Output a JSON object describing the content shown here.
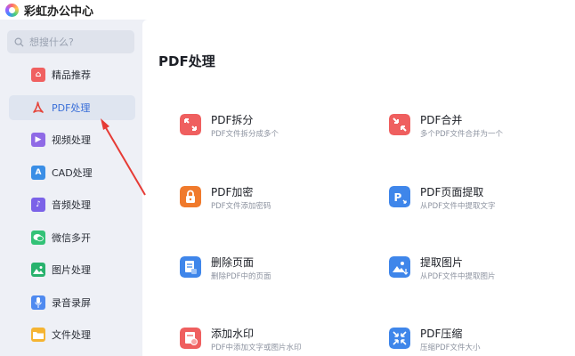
{
  "app": {
    "title": "彩虹办公中心"
  },
  "search": {
    "placeholder": "想搜什么?"
  },
  "sidebar": {
    "items": [
      {
        "label": "精品推荐",
        "icon": "home-icon",
        "color": "#f06060",
        "glyph": "⌂"
      },
      {
        "label": "PDF处理",
        "icon": "pdf-icon",
        "color": "#ffffff",
        "glyph": "A",
        "active": true
      },
      {
        "label": "视频处理",
        "icon": "video-icon",
        "color": "#8f6ae6",
        "glyph": "▶"
      },
      {
        "label": "CAD处理",
        "icon": "cad-icon",
        "color": "#3a8ee6",
        "glyph": "A"
      },
      {
        "label": "音频处理",
        "icon": "audio-icon",
        "color": "#7b62e8",
        "glyph": "♪"
      },
      {
        "label": "微信多开",
        "icon": "wechat-icon",
        "color": "#33c277",
        "glyph": "●"
      },
      {
        "label": "图片处理",
        "icon": "image-icon",
        "color": "#28b26d",
        "glyph": "▲"
      },
      {
        "label": "录音录屏",
        "icon": "mic-icon",
        "color": "#4f8af0",
        "glyph": "●"
      },
      {
        "label": "文件处理",
        "icon": "folder-icon",
        "color": "#f5b432",
        "glyph": "▬"
      }
    ]
  },
  "main": {
    "title": "PDF处理",
    "tools": [
      {
        "name": "PDF拆分",
        "desc": "PDF文件拆分成多个",
        "icon": "split-icon",
        "color": "#ef5f5f"
      },
      {
        "name": "PDF合并",
        "desc": "多个PDF文件合并为一个",
        "icon": "merge-icon",
        "color": "#ef5f5f"
      },
      {
        "name": "PDF加密",
        "desc": "PDF文件添加密码",
        "icon": "lock-icon",
        "color": "#f07a2c"
      },
      {
        "name": "PDF页面提取",
        "desc": "从PDF文件中提取文字",
        "icon": "page-extract-icon",
        "color": "#3f86ea"
      },
      {
        "name": "删除页面",
        "desc": "删除PDF中的页面",
        "icon": "delete-page-icon",
        "color": "#3f86ea"
      },
      {
        "name": "提取图片",
        "desc": "从PDF文件中提取图片",
        "icon": "image-extract-icon",
        "color": "#3f86ea"
      },
      {
        "name": "添加水印",
        "desc": "PDF中添加文字或图片水印",
        "icon": "watermark-icon",
        "color": "#ef5f5f"
      },
      {
        "name": "PDF压缩",
        "desc": "压缩PDF文件大小",
        "icon": "compress-icon",
        "color": "#3f86ea"
      }
    ]
  }
}
